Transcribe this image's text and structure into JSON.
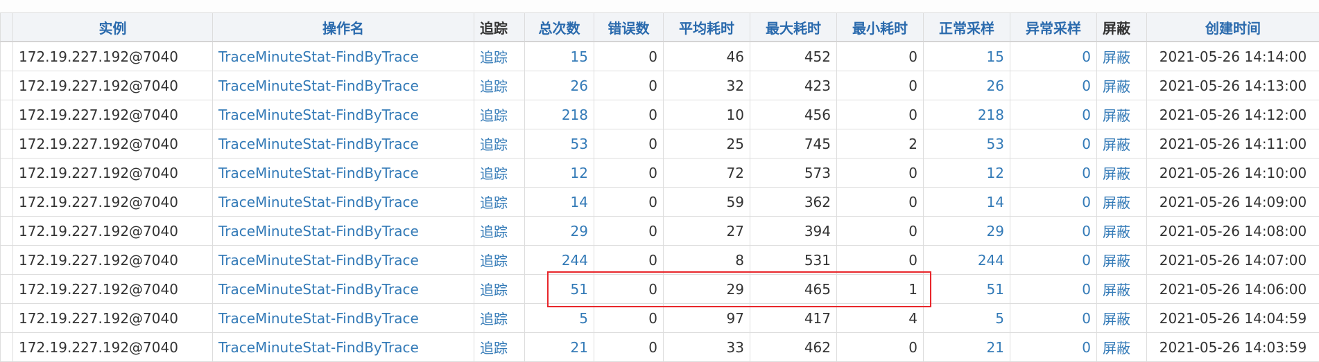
{
  "table": {
    "headers": [
      "实例",
      "操作名",
      "追踪",
      "总次数",
      "错误数",
      "平均耗时",
      "最大耗时",
      "最小耗时",
      "正常采样",
      "异常采样",
      "屏蔽",
      "创建时间"
    ],
    "rows": [
      {
        "instance": "172.19.227.192@7040",
        "op": "TraceMinuteStat-FindByTrace",
        "trace": "追踪",
        "total": "15",
        "errors": "0",
        "avg": "46",
        "max": "452",
        "min": "0",
        "normal": "15",
        "abnormal": "0",
        "block": "屏蔽",
        "created": "2021-05-26 14:14:00"
      },
      {
        "instance": "172.19.227.192@7040",
        "op": "TraceMinuteStat-FindByTrace",
        "trace": "追踪",
        "total": "26",
        "errors": "0",
        "avg": "32",
        "max": "423",
        "min": "0",
        "normal": "26",
        "abnormal": "0",
        "block": "屏蔽",
        "created": "2021-05-26 14:13:00"
      },
      {
        "instance": "172.19.227.192@7040",
        "op": "TraceMinuteStat-FindByTrace",
        "trace": "追踪",
        "total": "218",
        "errors": "0",
        "avg": "10",
        "max": "456",
        "min": "0",
        "normal": "218",
        "abnormal": "0",
        "block": "屏蔽",
        "created": "2021-05-26 14:12:00"
      },
      {
        "instance": "172.19.227.192@7040",
        "op": "TraceMinuteStat-FindByTrace",
        "trace": "追踪",
        "total": "53",
        "errors": "0",
        "avg": "25",
        "max": "745",
        "min": "2",
        "normal": "53",
        "abnormal": "0",
        "block": "屏蔽",
        "created": "2021-05-26 14:11:00"
      },
      {
        "instance": "172.19.227.192@7040",
        "op": "TraceMinuteStat-FindByTrace",
        "trace": "追踪",
        "total": "12",
        "errors": "0",
        "avg": "72",
        "max": "573",
        "min": "0",
        "normal": "12",
        "abnormal": "0",
        "block": "屏蔽",
        "created": "2021-05-26 14:10:00"
      },
      {
        "instance": "172.19.227.192@7040",
        "op": "TraceMinuteStat-FindByTrace",
        "trace": "追踪",
        "total": "14",
        "errors": "0",
        "avg": "59",
        "max": "362",
        "min": "0",
        "normal": "14",
        "abnormal": "0",
        "block": "屏蔽",
        "created": "2021-05-26 14:09:00"
      },
      {
        "instance": "172.19.227.192@7040",
        "op": "TraceMinuteStat-FindByTrace",
        "trace": "追踪",
        "total": "29",
        "errors": "0",
        "avg": "27",
        "max": "394",
        "min": "0",
        "normal": "29",
        "abnormal": "0",
        "block": "屏蔽",
        "created": "2021-05-26 14:08:00"
      },
      {
        "instance": "172.19.227.192@7040",
        "op": "TraceMinuteStat-FindByTrace",
        "trace": "追踪",
        "total": "244",
        "errors": "0",
        "avg": "8",
        "max": "531",
        "min": "0",
        "normal": "244",
        "abnormal": "0",
        "block": "屏蔽",
        "created": "2021-05-26 14:07:00"
      },
      {
        "instance": "172.19.227.192@7040",
        "op": "TraceMinuteStat-FindByTrace",
        "trace": "追踪",
        "total": "51",
        "errors": "0",
        "avg": "29",
        "max": "465",
        "min": "1",
        "normal": "51",
        "abnormal": "0",
        "block": "屏蔽",
        "created": "2021-05-26 14:06:00"
      },
      {
        "instance": "172.19.227.192@7040",
        "op": "TraceMinuteStat-FindByTrace",
        "trace": "追踪",
        "total": "5",
        "errors": "0",
        "avg": "97",
        "max": "417",
        "min": "4",
        "normal": "5",
        "abnormal": "0",
        "block": "屏蔽",
        "created": "2021-05-26 14:04:59"
      }
    ],
    "partial_row": {
      "instance": "172.19.227.192@7040",
      "op": "TraceMinuteStat-FindByTrace",
      "trace": "追踪",
      "total": "21",
      "errors": "0",
      "avg": "33",
      "max": "462",
      "min": "0",
      "normal": "21",
      "abnormal": "0",
      "block": "屏蔽",
      "created": "2021-05-26 14:03:59"
    }
  },
  "colors": {
    "link": "#337ab7",
    "header_text": "#2a6aad",
    "highlight_border": "#e8262b"
  }
}
